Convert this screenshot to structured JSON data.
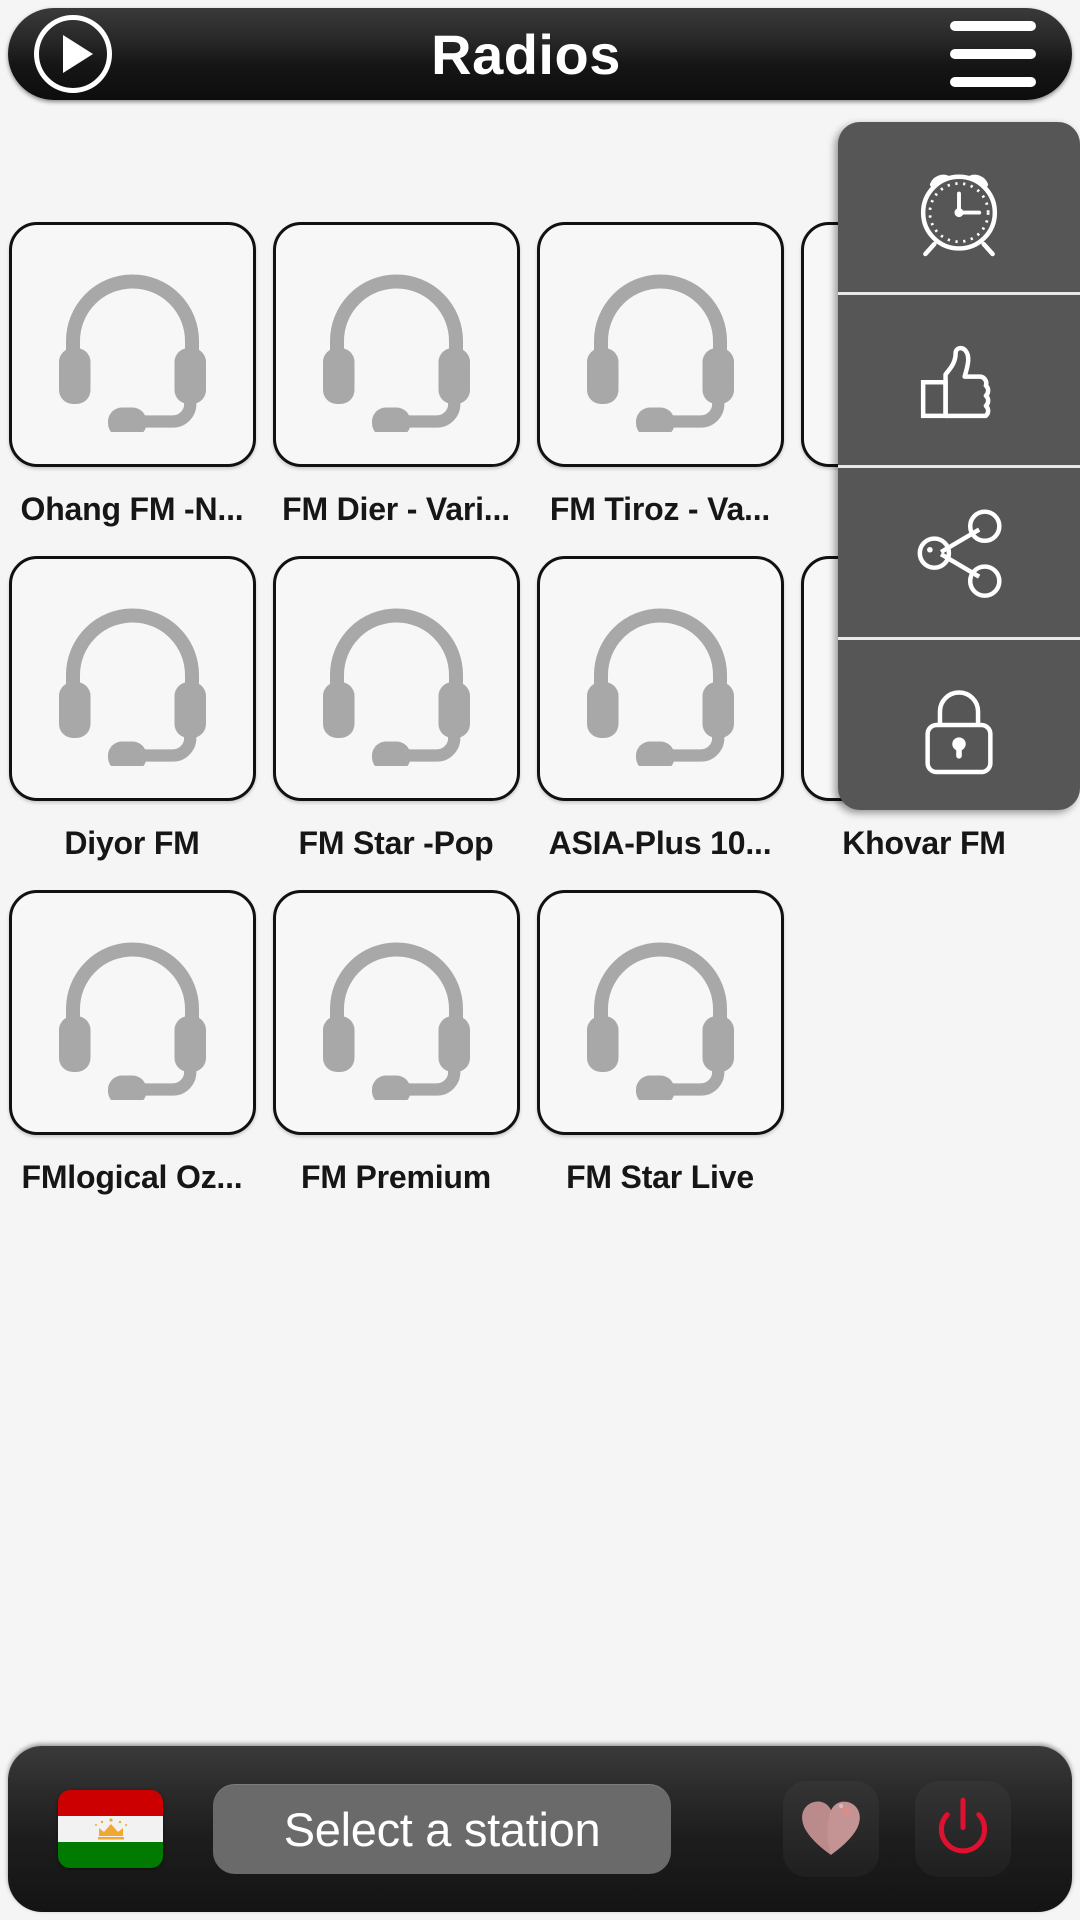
{
  "header": {
    "title": "Radios",
    "play_icon": "play-icon",
    "menu_icon": "hamburger-menu-icon"
  },
  "stations": [
    {
      "label": "Ohang FM -N...",
      "icon": "headset-icon"
    },
    {
      "label": "FM Dier - Vari...",
      "icon": "headset-icon"
    },
    {
      "label": "FM Tiroz - Va...",
      "icon": "headset-icon"
    },
    {
      "label": "",
      "icon": "headset-icon"
    },
    {
      "label": "Diyor FM",
      "icon": "headset-icon"
    },
    {
      "label": "FM Star -Pop",
      "icon": "headset-icon"
    },
    {
      "label": "ASIA-Plus 10...",
      "icon": "headset-icon"
    },
    {
      "label": "Khovar FM",
      "icon": "headset-icon"
    },
    {
      "label": "FMlogical Oz...",
      "icon": "headset-icon"
    },
    {
      "label": "FM Premium",
      "icon": "headset-icon"
    },
    {
      "label": "FM Star Live",
      "icon": "headset-icon"
    }
  ],
  "side_menu": {
    "items": [
      {
        "icon": "alarm-clock-icon"
      },
      {
        "icon": "thumbs-up-icon"
      },
      {
        "icon": "share-icon"
      },
      {
        "icon": "lock-icon"
      }
    ]
  },
  "bottom_bar": {
    "flag_icon": "tajikistan-flag-icon",
    "select_station_label": "Select a station",
    "favorite_icon": "heart-icon",
    "power_icon": "power-icon"
  },
  "colors": {
    "background": "#f5f5f5",
    "bar_dark": "#1d1d1d",
    "panel_gray": "#565656",
    "headset_gray": "#a8a8a8",
    "heart": "#c49393",
    "power_red": "#e01030",
    "flag_red": "#cc0000",
    "flag_green": "#007a00",
    "flag_gold": "#f0a830"
  }
}
